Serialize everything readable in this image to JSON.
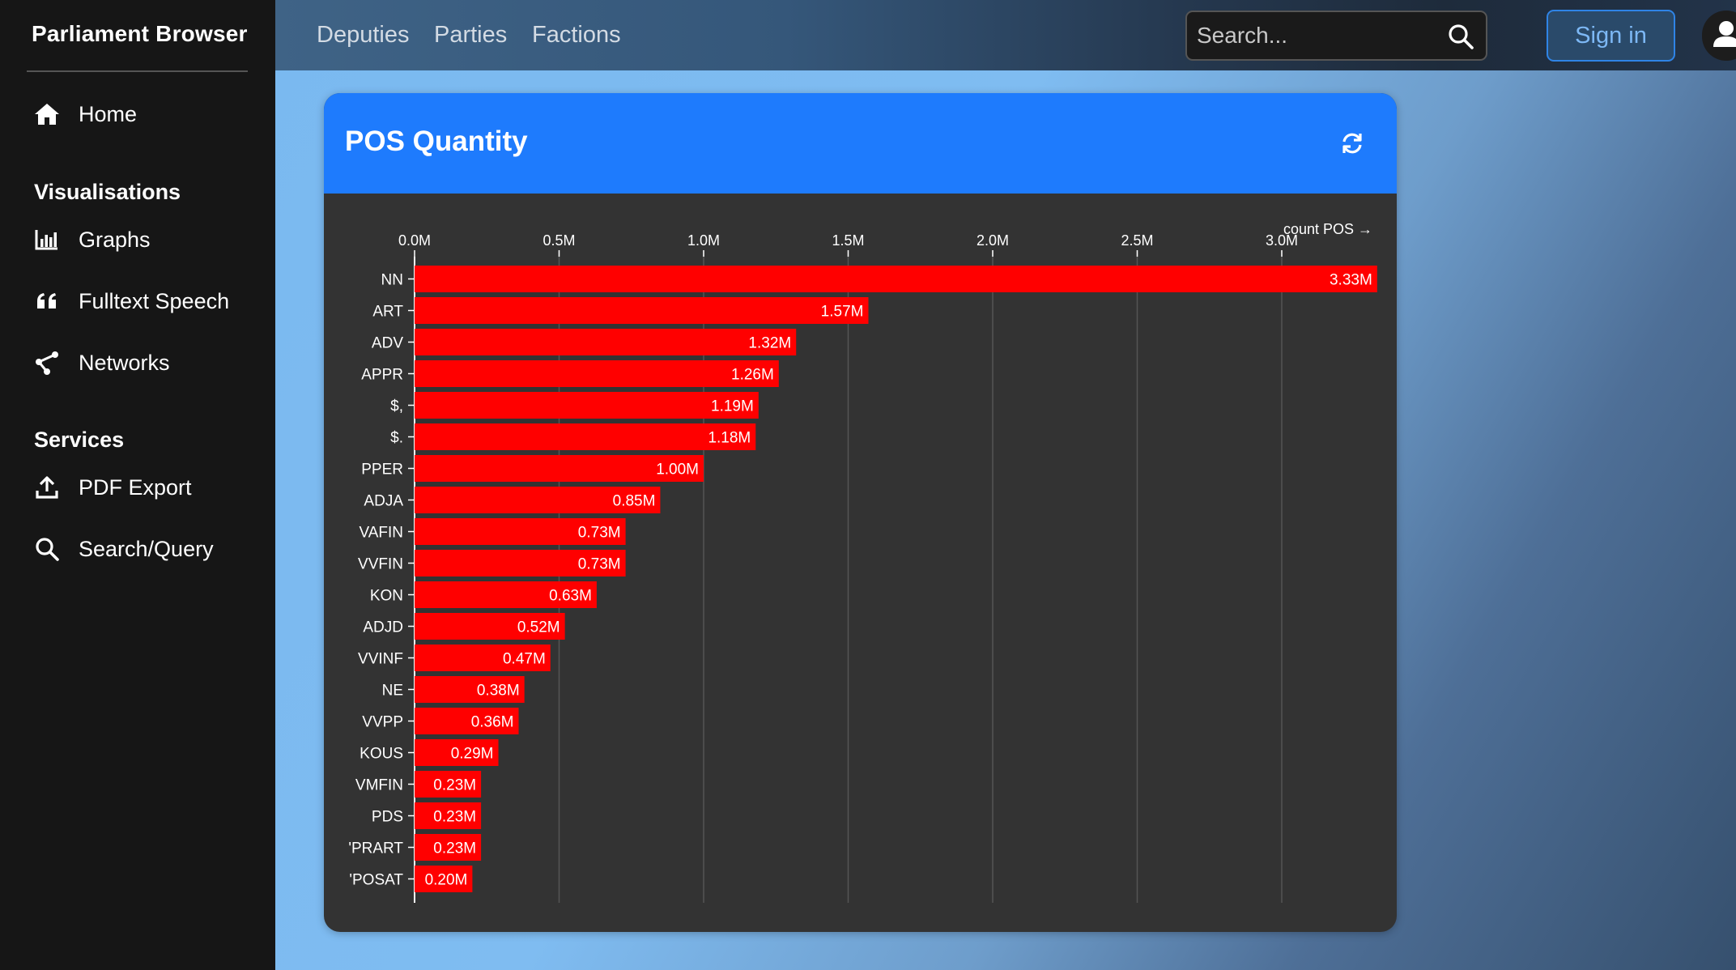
{
  "sidebar": {
    "brand": "Parliament Browser",
    "home": {
      "label": "Home",
      "icon": "home-icon"
    },
    "sections": [
      {
        "heading": "Visualisations",
        "items": [
          {
            "label": "Graphs",
            "icon": "bar-chart-icon"
          },
          {
            "label": "Fulltext Speech",
            "icon": "quote-icon"
          },
          {
            "label": "Networks",
            "icon": "share-icon"
          }
        ]
      },
      {
        "heading": "Services",
        "items": [
          {
            "label": "PDF Export",
            "icon": "upload-icon"
          },
          {
            "label": "Search/Query",
            "icon": "search-icon"
          }
        ]
      }
    ]
  },
  "topnav": {
    "links": [
      "Deputies",
      "Parties",
      "Factions"
    ],
    "search_placeholder": "Search...",
    "sign_in": "Sign in"
  },
  "card": {
    "title": "POS Quantity"
  },
  "colors": {
    "accent": "#1e7bfd",
    "bar": "#ff0000",
    "card_body": "#333333",
    "sidebar": "#161616"
  },
  "chart_data": {
    "type": "bar",
    "orientation": "horizontal",
    "axis_label": "count POS →",
    "xlim": [
      0,
      3.33
    ],
    "unit_suffix": "M",
    "ticks": [
      "0.0M",
      "0.5M",
      "1.0M",
      "1.5M",
      "2.0M",
      "2.5M",
      "3.0M"
    ],
    "tick_values": [
      0,
      0.5,
      1.0,
      1.5,
      2.0,
      2.5,
      3.0
    ],
    "grid": true,
    "categories": [
      "NN",
      "ART",
      "ADV",
      "APPR",
      "$,",
      "$.",
      "PPER",
      "ADJA",
      "VAFIN",
      "VVFIN",
      "KON",
      "ADJD",
      "VVINF",
      "NE",
      "VVPP",
      "KOUS",
      "VMFIN",
      "PDS",
      "'PRART",
      "'POSAT"
    ],
    "values": [
      3.33,
      1.57,
      1.32,
      1.26,
      1.19,
      1.18,
      1.0,
      0.85,
      0.73,
      0.73,
      0.63,
      0.52,
      0.47,
      0.38,
      0.36,
      0.29,
      0.23,
      0.23,
      0.23,
      0.2
    ],
    "labels": [
      "3.33M",
      "1.57M",
      "1.32M",
      "1.26M",
      "1.19M",
      "1.18M",
      "1.00M",
      "0.85M",
      "0.73M",
      "0.73M",
      "0.63M",
      "0.52M",
      "0.47M",
      "0.38M",
      "0.36M",
      "0.29M",
      "0.23M",
      "0.23M",
      "0.23M",
      "0.20M"
    ]
  }
}
